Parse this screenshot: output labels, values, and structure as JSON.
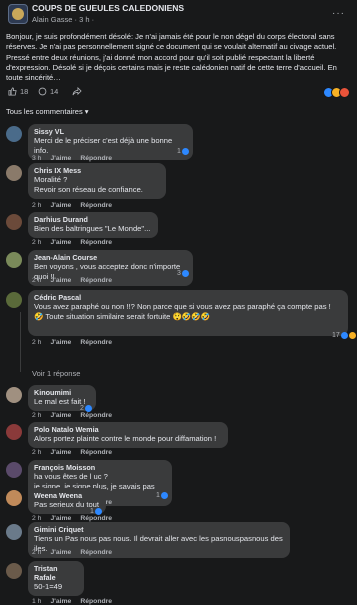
{
  "header": {
    "group_name": "COUPS DE GUEULES CALEDONIENS",
    "meta": "Alain Gasse · 3 h ·",
    "menu": "···"
  },
  "post": {
    "text": "Bonjour, je suis profondément désolé: Je n'ai jamais été pour le non dégel du corps électoral sans réserves. Je n'ai pas personnellement signé ce document qui se voulait alternatif au civage actuel. Pressé entre deux réunions, j'ai donné mon accord pour qu'il soit publié respectant la liberté d'expression. Désolé si je déçois certains mais je reste calédonien natif de cette terre d'accueil. En toute sincérité…"
  },
  "actions": {
    "likes": "18",
    "comments": "14"
  },
  "sort_label": "Tous les commentaires ▾",
  "comments": [
    {
      "name": "Sissy VL",
      "text": "Merci de le préciser c'est déjà une bonne info.",
      "time": "3 h",
      "likes": "1"
    },
    {
      "name": "Chris IX Mess",
      "text": "Moralité ?\nRevoir son réseau de confiance.",
      "time": "2 h",
      "likes": ""
    },
    {
      "name": "Darhius Durand",
      "text": "Bien des baltringues \"Le Monde\"...",
      "time": "2 h",
      "likes": ""
    },
    {
      "name": "Jean-Alain Course",
      "text": "Ben voyons , vous acceptez donc n'importe quoi !!",
      "time": "2 h",
      "likes": "3"
    },
    {
      "name": "Cédric Pascal",
      "text": "Vous avez paraphé ou non !!? Non parce que si vous avez pas paraphé ça compte pas ! 🤣 Toute situation similaire serait fortuite 😲🤣🤣🤣",
      "time": "2 h",
      "likes": "17"
    },
    {
      "name": "Kinoumimi",
      "text": "Le mal est fait !",
      "time": "2 h",
      "likes": "2"
    },
    {
      "name": "Polo Natalo Wemia",
      "text": "Alors portez plainte contre le monde pour diffamation !",
      "time": "2 h",
      "likes": ""
    },
    {
      "name": "François Moisson",
      "text": "ha vous êtes de l uc ?\nje signe, je signe plus, je savais pas 😮",
      "time": "2 h",
      "likes": "1"
    },
    {
      "name": "Weena Weena",
      "text": "Pas serieux du tout",
      "time": "2 h",
      "likes": "1"
    },
    {
      "name": "Gimini Criquet",
      "text": "Tiens un Pas nous pas nous. Il devrait aller avec les pasnouspasnous des iles.",
      "time": "2 h",
      "likes": ""
    },
    {
      "name": "Tristan Rafale",
      "text": "50-1=49",
      "time": "1 h",
      "likes": ""
    }
  ],
  "labels": {
    "like": "J'aime",
    "reply": "Répondre",
    "view_reply": "Voir 1 réponse"
  }
}
